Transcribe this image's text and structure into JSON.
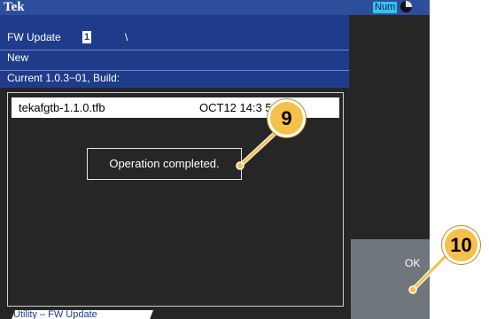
{
  "topbar": {
    "brand": "Tek",
    "num_badge": "Num",
    "status_icon": "pie-status-icon"
  },
  "header": {
    "title": "FW Update",
    "cursor_char": "1",
    "path": "\\",
    "subtitle": "New",
    "version": "Current  1.0.3−01, Build:"
  },
  "browser": {
    "selected_file": {
      "name": "tekafgtb-1.1.0.tfb",
      "date": "OCT12 14:3    5"
    }
  },
  "dialog": {
    "message": "Operation completed."
  },
  "softkey": {
    "ok_label": "OK"
  },
  "tab": {
    "label": "Utility – FW Update"
  },
  "callouts": {
    "nine": "9",
    "ten": "10"
  },
  "colors": {
    "header_blue": "#1f3c8a",
    "topbar_blue": "#2d4f9b",
    "num_badge": "#33c3ee",
    "callout_fill": "#f6c14a",
    "screen_bg": "#262626",
    "softkey_gray": "#6f767c"
  }
}
